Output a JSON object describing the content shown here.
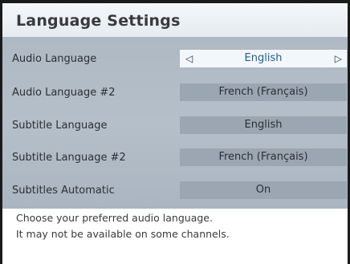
{
  "header": {
    "title": "Language Settings"
  },
  "settings": {
    "rows": [
      {
        "label": "Audio Language",
        "value": "English",
        "selected": true
      },
      {
        "label": "Audio Language #2",
        "value": "French (Français)",
        "selected": false
      },
      {
        "label": "Subtitle Language",
        "value": "English",
        "selected": false
      },
      {
        "label": "Subtitle Language #2",
        "value": "French (Français)",
        "selected": false
      },
      {
        "label": "Subtitles Automatic",
        "value": "On",
        "selected": false
      }
    ],
    "prev_arrow": "◁",
    "next_arrow": "▷"
  },
  "help": {
    "line1": "Choose your preferred audio language.",
    "line2": "It may not be available on some channels."
  }
}
